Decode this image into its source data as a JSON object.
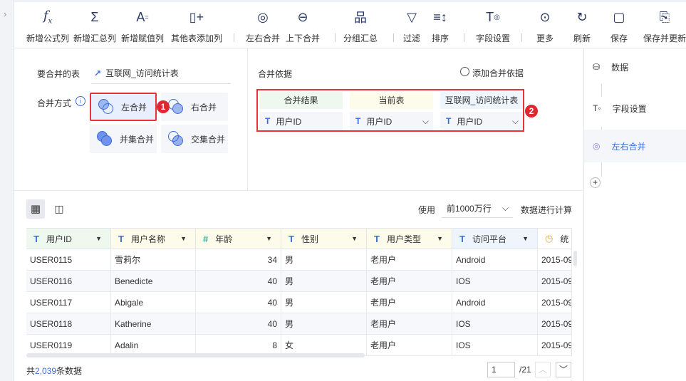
{
  "toolbar": {
    "items": [
      {
        "label": "新增公式列",
        "icon": "fx-icon"
      },
      {
        "label": "新增汇总列",
        "icon": "sigma-icon"
      },
      {
        "label": "新增赋值列",
        "icon": "assign-icon"
      },
      {
        "label": "其他表添加列",
        "icon": "add-column-icon"
      },
      {
        "label": "左右合并",
        "icon": "horizontal-merge-icon"
      },
      {
        "label": "上下合并",
        "icon": "vertical-merge-icon"
      },
      {
        "label": "分组汇总",
        "icon": "group-icon"
      },
      {
        "label": "过滤",
        "icon": "filter-icon"
      },
      {
        "label": "排序",
        "icon": "sort-icon"
      },
      {
        "label": "字段设置",
        "icon": "field-settings-icon"
      },
      {
        "label": "更多",
        "icon": "more-icon"
      },
      {
        "label": "刷新",
        "icon": "refresh-icon"
      },
      {
        "label": "保存",
        "icon": "save-icon"
      },
      {
        "label": "保存并更新",
        "icon": "save-update-icon"
      }
    ]
  },
  "config": {
    "table_label": "要合并的表",
    "table_name": "互联网_访问统计表",
    "method_label": "合并方式",
    "methods": [
      "左合并",
      "右合并",
      "并集合并",
      "交集合并"
    ],
    "selected_method": "左合并",
    "basis_label": "合并依据",
    "add_basis": "添加合并依据",
    "basis_headers": [
      "合并结果",
      "当前表",
      "互联网_访问统计表"
    ],
    "basis_values": [
      "用户ID",
      "用户ID",
      "用户ID"
    ],
    "badges": [
      "1",
      "2"
    ]
  },
  "sidebar": {
    "items": [
      "数据",
      "字段设置",
      "左右合并"
    ],
    "active": "左右合并"
  },
  "table": {
    "use_label": "使用",
    "row_limit": "前1000万行",
    "compute_label": "数据进行计算",
    "columns": [
      {
        "name": "用户ID",
        "type": "T"
      },
      {
        "name": "用户名称",
        "type": "T"
      },
      {
        "name": "年龄",
        "type": "#"
      },
      {
        "name": "性别",
        "type": "T"
      },
      {
        "name": "用户类型",
        "type": "T"
      },
      {
        "name": "访问平台",
        "type": "T"
      },
      {
        "name": "统",
        "type": "time"
      }
    ],
    "rows": [
      [
        "USER0115",
        "雪莉尔",
        "34",
        "男",
        "老用户",
        "Android",
        "2015-09"
      ],
      [
        "USER0116",
        "Benedicte",
        "40",
        "男",
        "老用户",
        "IOS",
        "2015-09"
      ],
      [
        "USER0117",
        "Abigale",
        "40",
        "男",
        "老用户",
        "Android",
        "2015-09"
      ],
      [
        "USER0118",
        "Katherine",
        "40",
        "男",
        "老用户",
        "IOS",
        "2015-09"
      ],
      [
        "USER0119",
        "Adalin",
        "8",
        "女",
        "老用户",
        "IOS",
        "2015-09"
      ]
    ]
  },
  "footer": {
    "prefix": "共",
    "count": "2,039",
    "suffix": "条数据",
    "page": "1",
    "total_pages": "/21"
  }
}
